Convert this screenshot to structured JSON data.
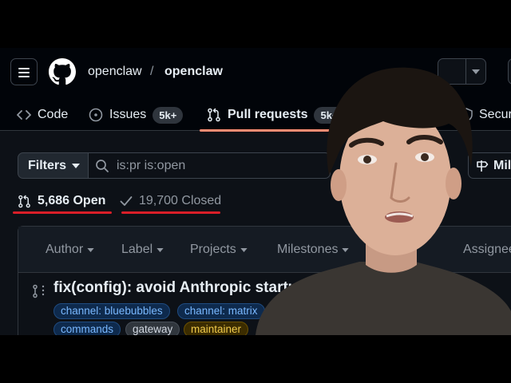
{
  "header": {
    "owner": "openclaw",
    "separator": "/",
    "repo": "openclaw"
  },
  "tabs": [
    {
      "label": "Code",
      "icon": "code-icon"
    },
    {
      "label": "Issues",
      "icon": "issue-icon",
      "count": "5k+"
    },
    {
      "label": "Pull requests",
      "icon": "pull-request-icon",
      "count": "5k+",
      "active": true
    },
    {
      "label": "Securit",
      "icon": "shield-icon"
    }
  ],
  "filters": {
    "button_label": "Filters",
    "search_value": "is:pr is:open",
    "milestones_button": "Mile"
  },
  "state": {
    "open_label": "5,686 Open",
    "closed_label": "19,700 Closed",
    "underline_color": "#da1e28"
  },
  "list_header": {
    "author": "Author",
    "label": "Label",
    "projects": "Projects",
    "milestones": "Milestones",
    "assignee": "Assignee"
  },
  "pull_requests": [
    {
      "title": "fix(config): avoid Anthropic startup crash",
      "labels": [
        {
          "text": "channel: bluebubbles",
          "color": "blue"
        },
        {
          "text": "channel: matrix",
          "color": "blue"
        },
        {
          "text": "commands",
          "color": "blue"
        },
        {
          "text": "gateway",
          "color": "gray"
        },
        {
          "text": "maintainer",
          "color": "yellow"
        }
      ]
    }
  ],
  "colors": {
    "background": "#0d1117",
    "header_background": "#010409",
    "active_tab_underline": "#fd8c73",
    "open_icon": "#3fb950"
  }
}
